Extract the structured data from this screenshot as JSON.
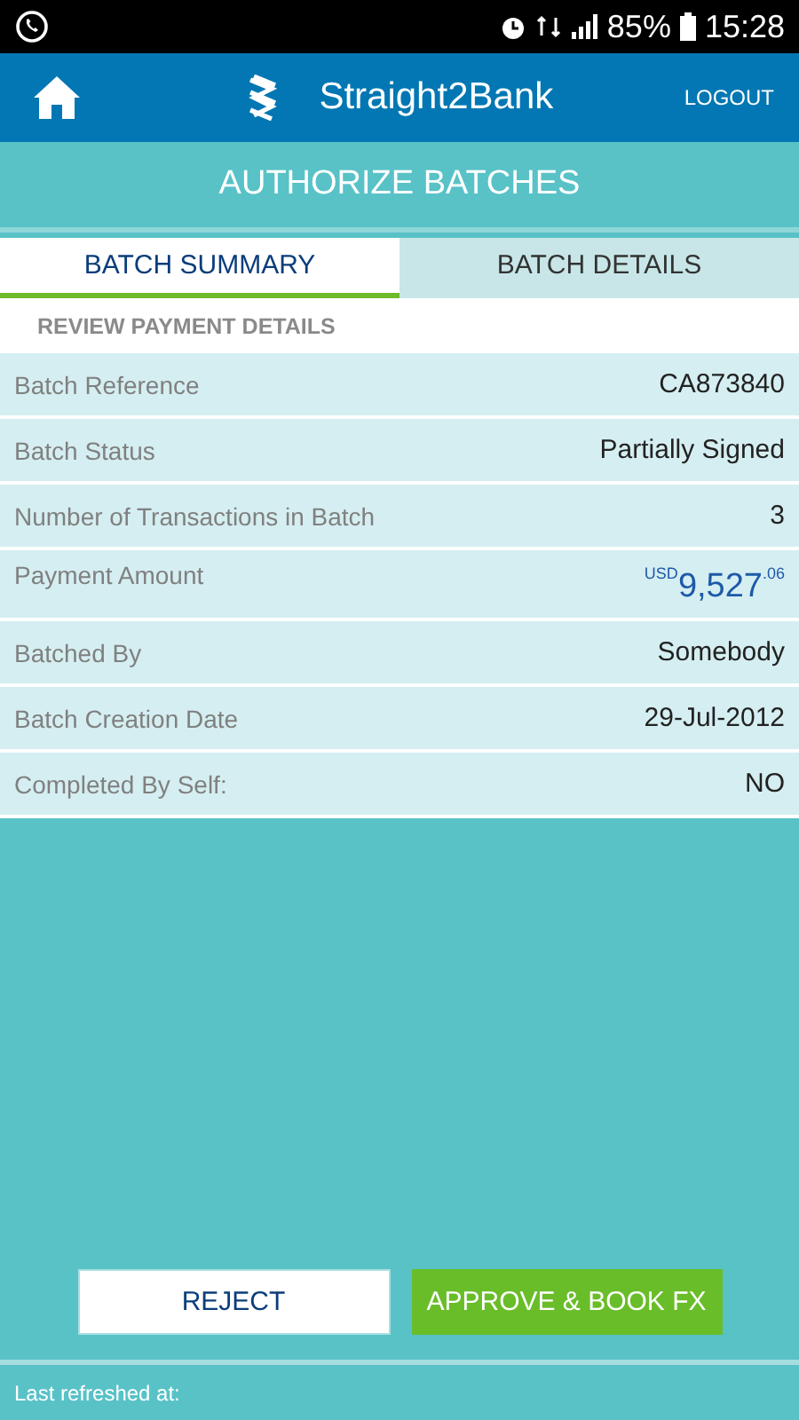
{
  "status_bar": {
    "battery": "85%",
    "time": "15:28"
  },
  "header": {
    "app_name": "Straight2Bank",
    "logout": "LOGOUT"
  },
  "page_title": "AUTHORIZE BATCHES",
  "tabs": [
    {
      "label": "BATCH SUMMARY",
      "selected": true
    },
    {
      "label": "BATCH DETAILS",
      "selected": false
    }
  ],
  "section_title": "REVIEW PAYMENT DETAILS",
  "details": [
    {
      "kind": "text",
      "label": "Batch Reference",
      "value": "CA873840"
    },
    {
      "kind": "text",
      "label": "Batch Status",
      "value": "Partially Signed"
    },
    {
      "kind": "text",
      "label": "Number of Transactions in Batch",
      "value": "3"
    },
    {
      "kind": "amount",
      "label": "Payment Amount",
      "currency": "USD",
      "whole": "9,527",
      "cents": ".06"
    },
    {
      "kind": "text",
      "label": "Batched By",
      "value": "Somebody"
    },
    {
      "kind": "text",
      "label": "Batch Creation Date",
      "value": "29-Jul-2012"
    },
    {
      "kind": "text",
      "label": "Completed By Self:",
      "value": "NO"
    }
  ],
  "buttons": [
    {
      "kind": "secondary",
      "label": "REJECT"
    },
    {
      "kind": "primary",
      "label": "APPROVE & BOOK FX"
    }
  ],
  "footer": {
    "text": "Last refreshed at:"
  }
}
